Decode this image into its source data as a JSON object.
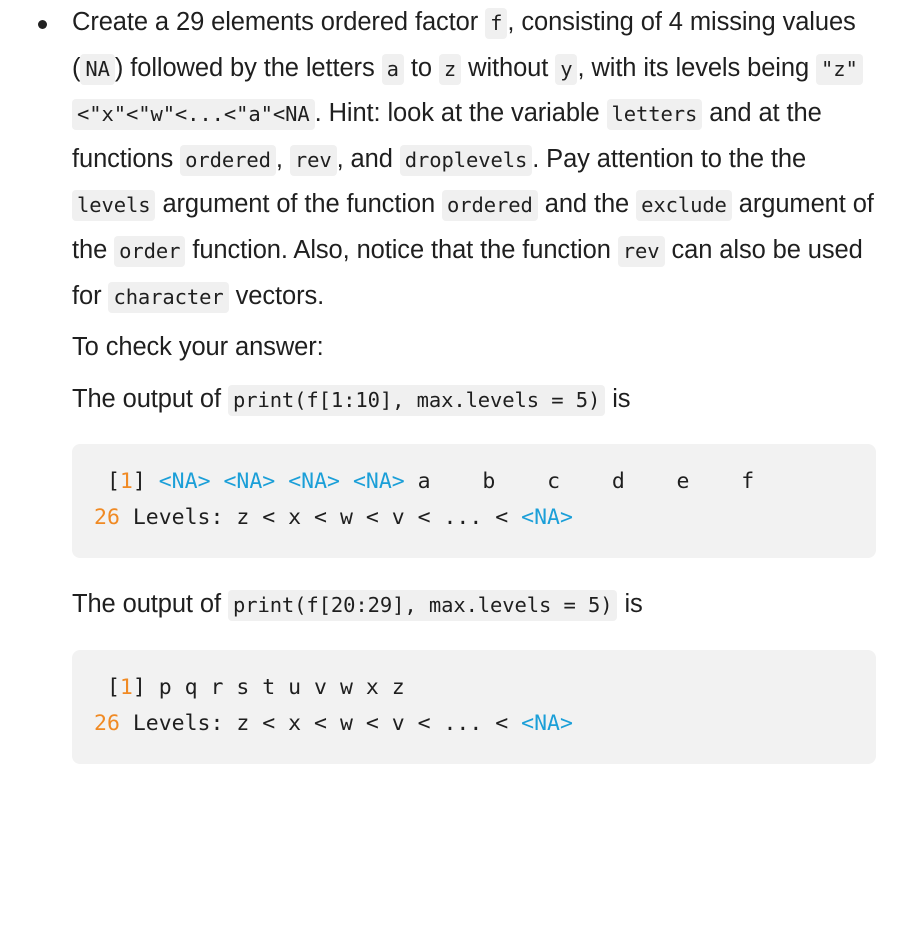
{
  "exercise": {
    "bullet_icon": "bullet-dot-icon",
    "paragraph_1": {
      "segments": [
        {
          "type": "text",
          "value": "Create a 29 elements ordered factor "
        },
        {
          "type": "code",
          "value": "f"
        },
        {
          "type": "text",
          "value": ", consisting of 4 missing values ("
        },
        {
          "type": "code",
          "value": "NA"
        },
        {
          "type": "text",
          "value": ") followed by the letters "
        },
        {
          "type": "code",
          "value": "a"
        },
        {
          "type": "text",
          "value": " to "
        },
        {
          "type": "code",
          "value": "z"
        },
        {
          "type": "text",
          "value": " without "
        },
        {
          "type": "code",
          "value": "y"
        },
        {
          "type": "text",
          "value": ", with its levels being "
        },
        {
          "type": "code",
          "value": "\"z\"<\"x\"<\"w\"<...<\"a\"<NA"
        },
        {
          "type": "text",
          "value": ". Hint: look at the variable "
        },
        {
          "type": "code",
          "value": "letters"
        },
        {
          "type": "text",
          "value": " and at the functions "
        },
        {
          "type": "code",
          "value": "ordered"
        },
        {
          "type": "text",
          "value": ", "
        },
        {
          "type": "code",
          "value": "rev"
        },
        {
          "type": "text",
          "value": ", and "
        },
        {
          "type": "code",
          "value": "droplevels"
        },
        {
          "type": "text",
          "value": ". Pay attention to the the "
        },
        {
          "type": "code",
          "value": "levels"
        },
        {
          "type": "text",
          "value": " argument of the function "
        },
        {
          "type": "code",
          "value": "ordered"
        },
        {
          "type": "text",
          "value": " and the "
        },
        {
          "type": "code",
          "value": "exclude"
        },
        {
          "type": "text",
          "value": " argument of the "
        },
        {
          "type": "code",
          "value": "order"
        },
        {
          "type": "text",
          "value": " function. Also, notice that the function "
        },
        {
          "type": "code",
          "value": "rev"
        },
        {
          "type": "text",
          "value": " can also be used for "
        },
        {
          "type": "code",
          "value": "character"
        },
        {
          "type": "text",
          "value": " vectors."
        }
      ]
    },
    "check_answer_text": "To check your answer:",
    "outputs": [
      {
        "intro_prefix": "The output of ",
        "intro_code": "print(f[1:10], max.levels = 5)",
        "intro_suffix": " is",
        "console_lines": [
          [
            {
              "type": "plain",
              "value": " ["
            },
            {
              "type": "num",
              "value": "1"
            },
            {
              "type": "plain",
              "value": "] "
            },
            {
              "type": "na",
              "value": "<NA>"
            },
            {
              "type": "plain",
              "value": " "
            },
            {
              "type": "na",
              "value": "<NA>"
            },
            {
              "type": "plain",
              "value": " "
            },
            {
              "type": "na",
              "value": "<NA>"
            },
            {
              "type": "plain",
              "value": " "
            },
            {
              "type": "na",
              "value": "<NA>"
            },
            {
              "type": "plain",
              "value": " a    b    c    d    e    f"
            }
          ],
          [
            {
              "type": "num",
              "value": "26"
            },
            {
              "type": "plain",
              "value": " Levels: z < x < w < v < ... < "
            },
            {
              "type": "na",
              "value": "<NA>"
            }
          ]
        ]
      },
      {
        "intro_prefix": "The output of ",
        "intro_code": "print(f[20:29], max.levels = 5)",
        "intro_suffix": " is",
        "console_lines": [
          [
            {
              "type": "plain",
              "value": " ["
            },
            {
              "type": "num",
              "value": "1"
            },
            {
              "type": "plain",
              "value": "] p q r s t u v w x z"
            }
          ],
          [
            {
              "type": "num",
              "value": "26"
            },
            {
              "type": "plain",
              "value": " Levels: z < x < w < v < ... < "
            },
            {
              "type": "na",
              "value": "<NA>"
            }
          ]
        ]
      }
    ]
  },
  "colors": {
    "text": "#1f1f1f",
    "chip_background": "#f0f0f0",
    "console_background": "#f2f2f2",
    "console_number": "#f08a24",
    "console_na": "#1b9fd8",
    "page_background": "#ffffff"
  }
}
